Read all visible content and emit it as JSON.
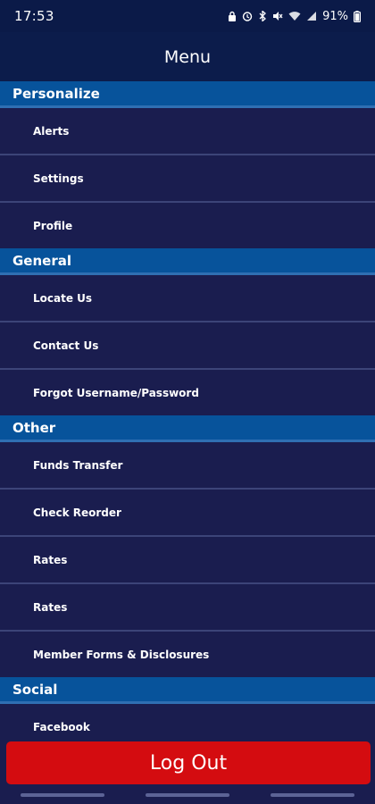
{
  "status_bar": {
    "time": "17:53",
    "battery": "91%",
    "icons": [
      "lock-icon",
      "alarm-icon",
      "bluetooth-icon",
      "mute-icon",
      "wifi-icon",
      "signal-icon"
    ]
  },
  "header": {
    "title": "Menu"
  },
  "sections": [
    {
      "title": "Personalize",
      "items": [
        "Alerts",
        "Settings",
        "Profile"
      ]
    },
    {
      "title": "General",
      "items": [
        "Locate Us",
        "Contact Us",
        "Forgot Username/Password"
      ]
    },
    {
      "title": "Other",
      "items": [
        "Funds Transfer",
        "Check Reorder",
        "Rates",
        "Rates",
        "Member Forms & Disclosures"
      ]
    },
    {
      "title": "Social",
      "items": [
        "Facebook"
      ]
    }
  ],
  "logout": {
    "label": "Log Out"
  },
  "colors": {
    "background": "#1a1d4f",
    "header": "#0c1c4b",
    "section": "#07539b",
    "logout": "#d40c10"
  }
}
